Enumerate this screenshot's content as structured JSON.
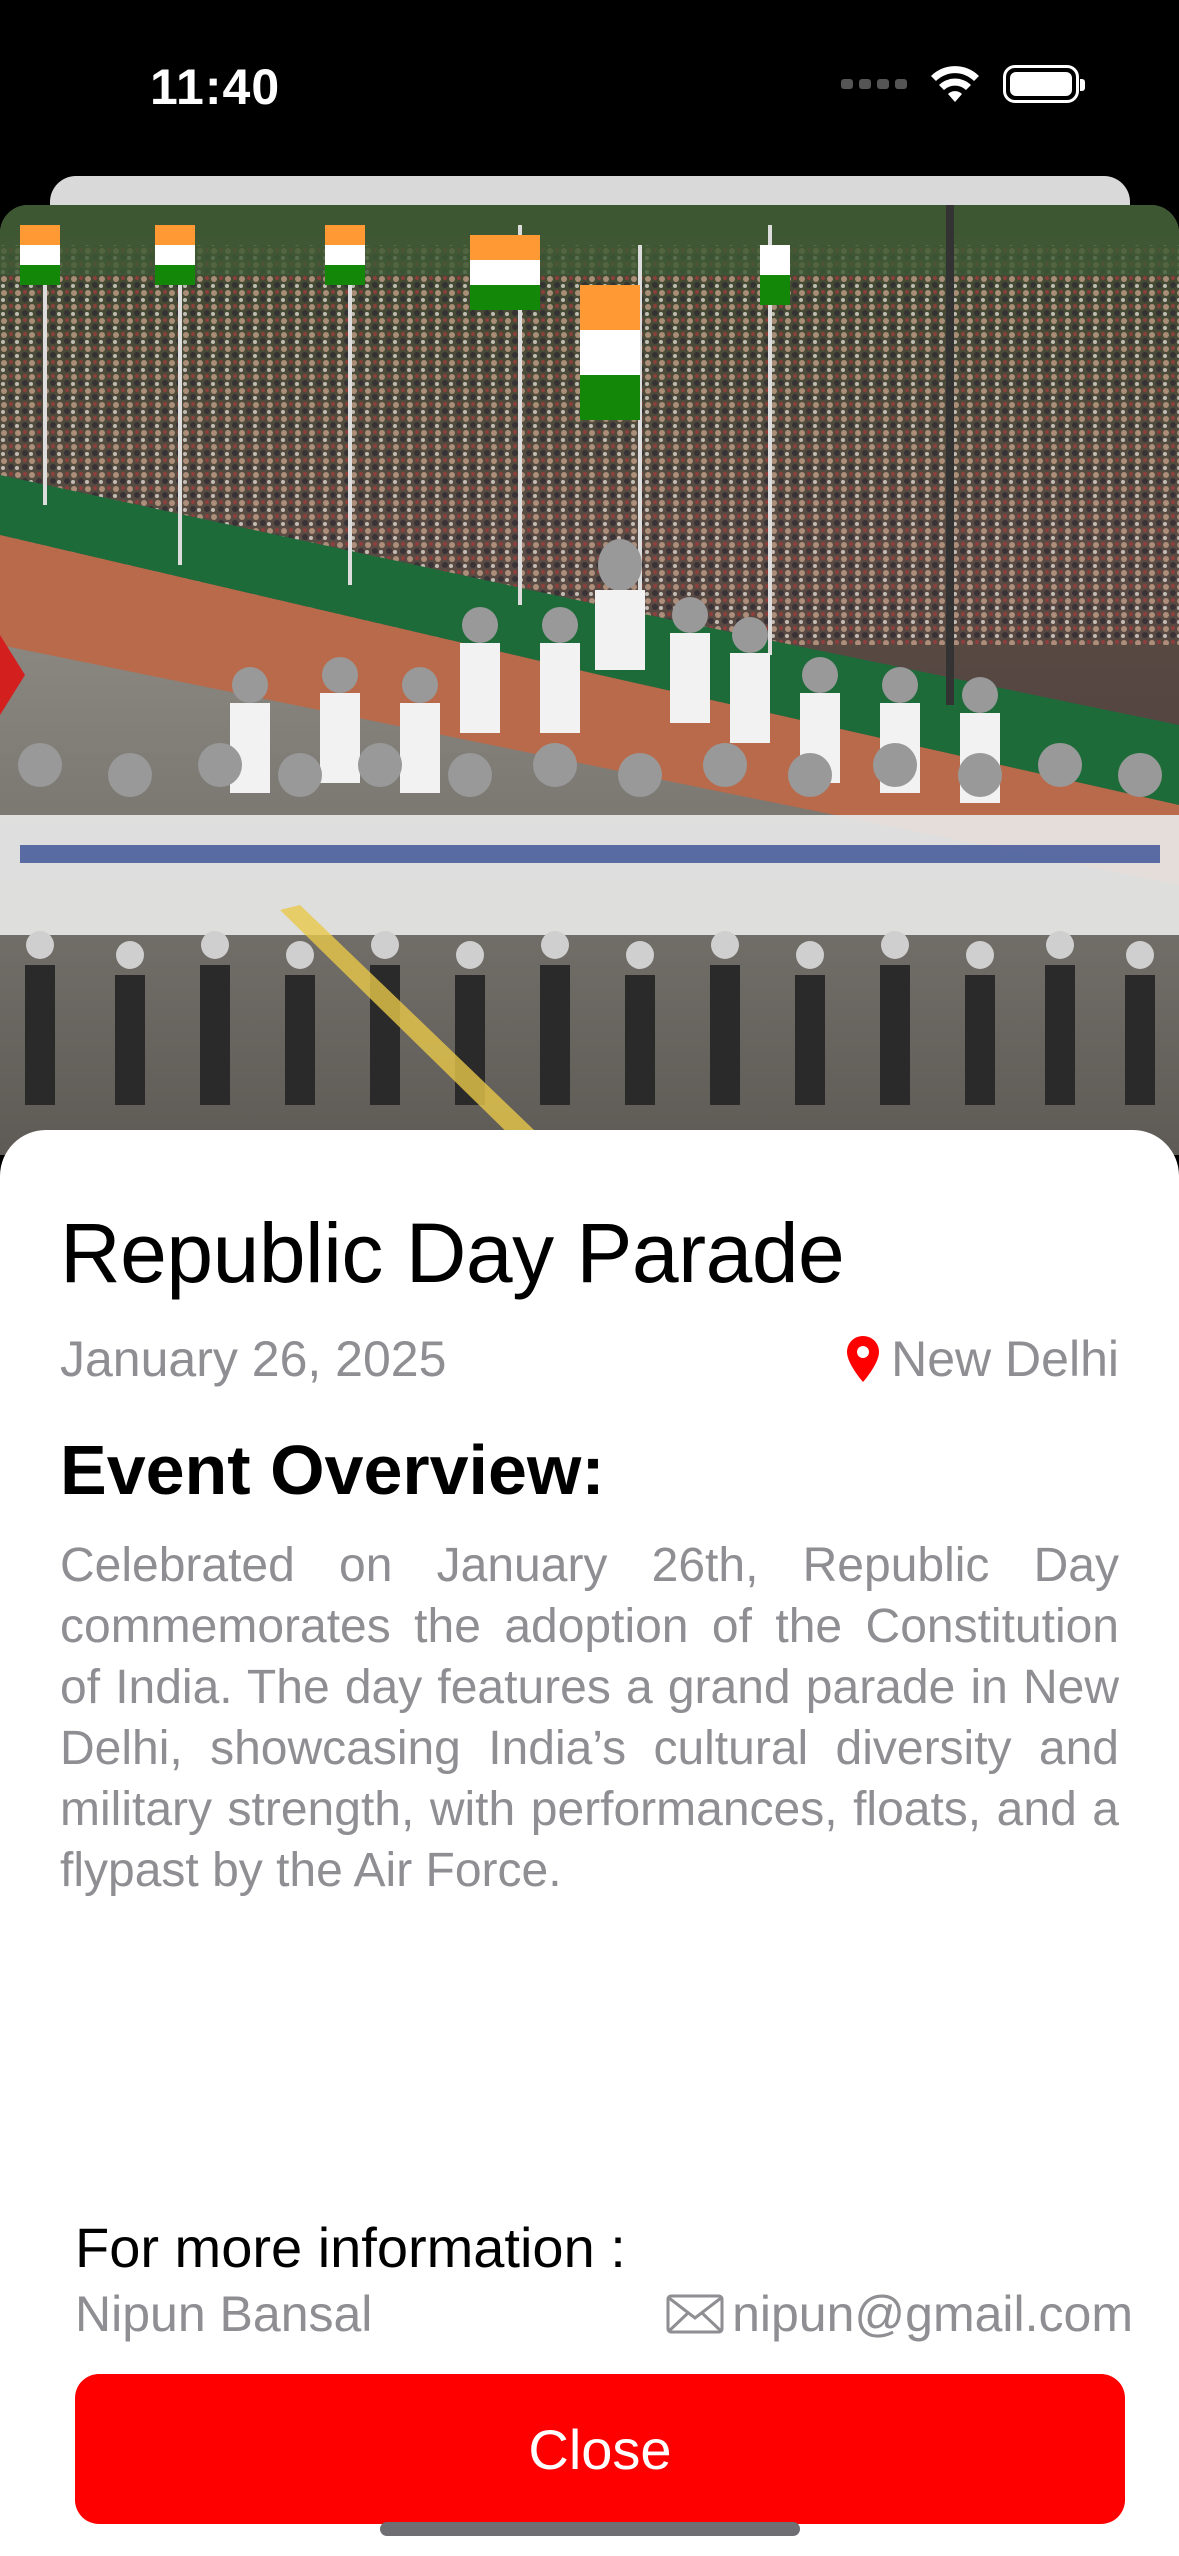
{
  "status_bar": {
    "time": "11:40",
    "icons": [
      "signal-icon",
      "wifi-icon",
      "battery-icon"
    ]
  },
  "hero_image": {
    "description_icon": "parade-photo"
  },
  "event": {
    "title": "Republic Day Parade",
    "date": "January 26, 2025",
    "location": "New Delhi",
    "overview_heading": "Event Overview:",
    "overview_text": "Celebrated on January 26th, Republic Day commemorates the adoption of the Constitution of India. The day features a grand parade in New Delhi, showcasing India’s cultural diversity and military strength, with performances, floats, and a flypast by the Air Force."
  },
  "contact": {
    "heading": "For more information :",
    "name": "Nipun Bansal",
    "email": "nipun@gmail.com"
  },
  "actions": {
    "close_label": "Close"
  },
  "colors": {
    "accent": "#ff0000",
    "secondary_text": "#8e8e93"
  }
}
